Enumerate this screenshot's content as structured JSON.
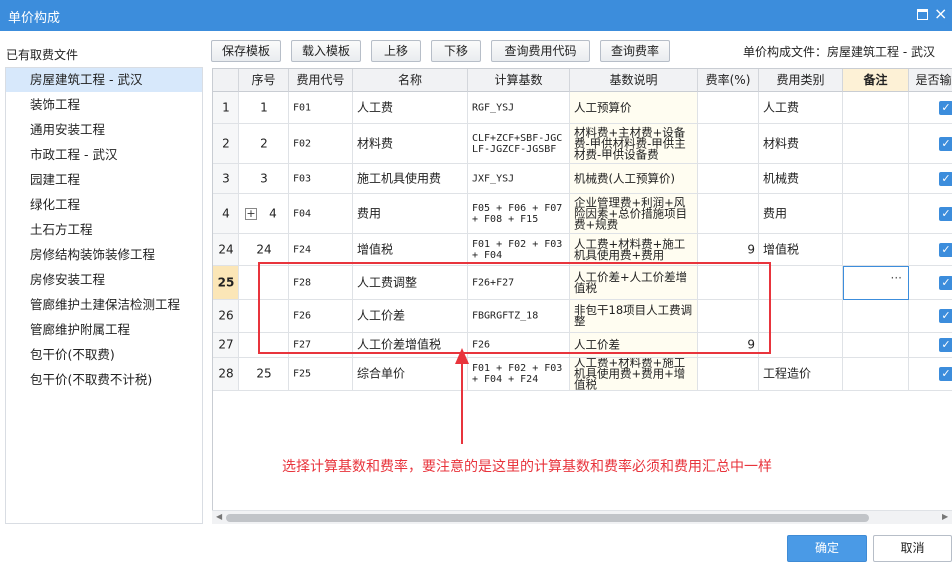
{
  "window": {
    "title": "单价构成"
  },
  "left": {
    "title": "已有取费文件",
    "items": [
      "房屋建筑工程 - 武汉",
      "装饰工程",
      "通用安装工程",
      "市政工程 - 武汉",
      "园建工程",
      "绿化工程",
      "土石方工程",
      "房修结构装饰装修工程",
      "房修安装工程",
      "管廊维护土建保洁检测工程",
      "管廊维护附属工程",
      "包干价(不取费)",
      "包干价(不取费不计税)"
    ]
  },
  "toolbar": {
    "save_template": "保存模板",
    "load_template": "载入模板",
    "move_up": "上移",
    "move_down": "下移",
    "query_code": "查询费用代码",
    "query_rate": "查询费率",
    "file_label": "单价构成文件：",
    "file_value": "房屋建筑工程 - 武汉"
  },
  "table": {
    "headers": [
      "",
      "序号",
      "费用代号",
      "名称",
      "计算基数",
      "基数说明",
      "费率(%)",
      "费用类别",
      "备注",
      "是否输"
    ],
    "rows": [
      {
        "idx": "1",
        "seq": "1",
        "code": "F01",
        "name": "人工费",
        "base": "RGF_YSJ",
        "desc": "人工预算价",
        "rate": "",
        "type": "人工费",
        "checked": true
      },
      {
        "idx": "2",
        "seq": "2",
        "code": "F02",
        "name": "材料费",
        "base": "CLF+ZCF+SBF-JGCLF-JGZCF-JGSBF",
        "desc": "材料费+主材费+设备费-甲供材料费-甲供主材费-甲供设备费",
        "rate": "",
        "type": "材料费",
        "checked": true
      },
      {
        "idx": "3",
        "seq": "3",
        "code": "F03",
        "name": "施工机具使用费",
        "base": "JXF_YSJ",
        "desc": "机械费(人工预算价)",
        "rate": "",
        "type": "机械费",
        "checked": true
      },
      {
        "idx": "4",
        "seq": "4",
        "code": "F04",
        "name": "费用",
        "base": "F05 + F06 + F07 + F08 + F15",
        "desc": "企业管理费+利润+风险因素+总价措施项目费+规费",
        "rate": "",
        "type": "费用",
        "checked": true,
        "expand": "+"
      },
      {
        "idx": "24",
        "seq": "24",
        "code": "F24",
        "name": "增值税",
        "base": "F01 + F02 + F03 + F04",
        "desc": "人工费+材料费+施工机具使用费+费用",
        "rate": "9",
        "type": "增值税",
        "checked": true
      },
      {
        "idx": "25",
        "seq": "",
        "code": "F28",
        "name": "人工费调整",
        "base": "F26+F27",
        "desc": "人工价差+人工价差增值税",
        "rate": "",
        "type": "",
        "checked": true,
        "active": true,
        "edit_dots": "···"
      },
      {
        "idx": "26",
        "seq": "",
        "code": "F26",
        "name": "人工价差",
        "base": "FBGRGFTZ_18",
        "desc": "非包干18项目人工费调整",
        "rate": "",
        "type": "",
        "checked": true
      },
      {
        "idx": "27",
        "seq": "",
        "code": "F27",
        "name": "人工价差增值税",
        "base": "F26",
        "desc": "人工价差",
        "rate": "9",
        "type": "",
        "checked": true
      },
      {
        "idx": "28",
        "seq": "25",
        "code": "F25",
        "name": "综合单价",
        "base": "F01 + F02 + F03 + F04 + F24",
        "desc": "人工费+材料费+施工机具使用费+费用+增值税",
        "rate": "",
        "type": "工程造价",
        "checked": true
      }
    ]
  },
  "annotation": "选择计算基数和费率，要注意的是这里的计算基数和费率必须和费用汇总中一样",
  "footer": {
    "ok": "确定",
    "cancel": "取消"
  },
  "colors": {
    "titlebar": "#3c8ddc",
    "annotation": "#e8343c",
    "selected": "#d7e8fb",
    "remark_header": "#fdf1d6"
  }
}
